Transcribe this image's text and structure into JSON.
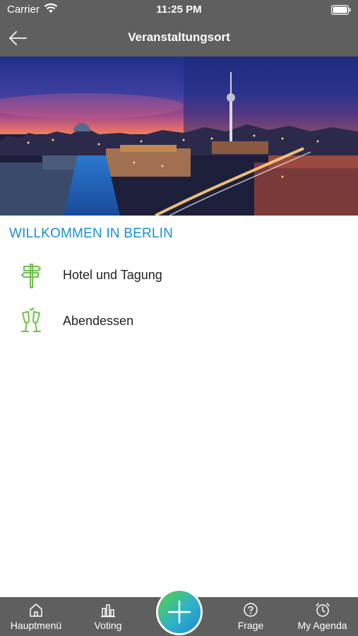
{
  "status": {
    "carrier": "Carrier",
    "time": "11:25 PM"
  },
  "nav": {
    "title": "Veranstaltungsort"
  },
  "section": {
    "title": "WILLKOMMEN IN BERLIN"
  },
  "items": [
    {
      "label": "Hotel und Tagung",
      "icon": "signpost-icon"
    },
    {
      "label": "Abendessen",
      "icon": "champagne-glasses-icon"
    }
  ],
  "tabs": [
    {
      "label": "Hauptmenü",
      "icon": "home-icon"
    },
    {
      "label": "Voting",
      "icon": "bar-chart-icon"
    },
    {
      "label": "Frage",
      "icon": "question-icon"
    },
    {
      "label": "My Agenda",
      "icon": "alarm-clock-icon"
    }
  ],
  "colors": {
    "bars": "#5f5f5f",
    "accent": "#1a8fd0",
    "icon_green": "#6cc24a"
  }
}
